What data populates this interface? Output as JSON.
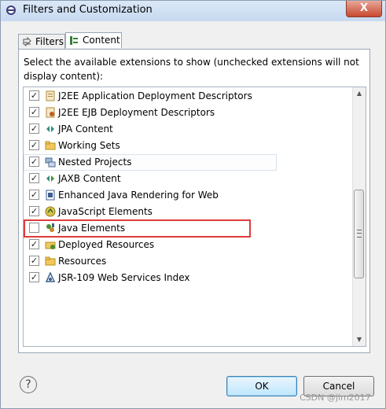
{
  "window": {
    "title": "Filters and Customization",
    "close_label": "X"
  },
  "tabs": [
    {
      "label": "Filters",
      "icon": "filters-icon",
      "selected": false
    },
    {
      "label": "Content",
      "icon": "content-icon",
      "selected": true
    }
  ],
  "instructions": "Select the available extensions to show (unchecked extensions will not display content):",
  "items": [
    {
      "label": "J2EE Application Deployment Descriptors",
      "checked": true,
      "icon": "j2ee-app-descriptor-icon"
    },
    {
      "label": "J2EE EJB Deployment Descriptors",
      "checked": true,
      "icon": "ejb-descriptor-icon"
    },
    {
      "label": "JPA Content",
      "checked": true,
      "icon": "jpa-icon"
    },
    {
      "label": "Working Sets",
      "checked": true,
      "icon": "working-sets-icon"
    },
    {
      "label": "Nested Projects",
      "checked": true,
      "icon": "nested-projects-icon"
    },
    {
      "label": "JAXB Content",
      "checked": true,
      "icon": "jaxb-icon"
    },
    {
      "label": "Enhanced Java Rendering for Web",
      "checked": true,
      "icon": "java-web-icon"
    },
    {
      "label": "JavaScript Elements",
      "checked": true,
      "icon": "javascript-icon"
    },
    {
      "label": "Java Elements",
      "checked": false,
      "icon": "java-elements-icon"
    },
    {
      "label": "Deployed Resources",
      "checked": true,
      "icon": "deployed-resources-icon"
    },
    {
      "label": "Resources",
      "checked": true,
      "icon": "resources-icon"
    },
    {
      "label": "JSR-109 Web Services Index",
      "checked": true,
      "icon": "web-services-icon"
    }
  ],
  "buttons": {
    "help": "?",
    "ok": "OK",
    "cancel": "Cancel"
  },
  "watermark": "CSDN @jim2017",
  "colors": {
    "highlight": "#e03c3c",
    "accent": "#3c7fb1"
  }
}
